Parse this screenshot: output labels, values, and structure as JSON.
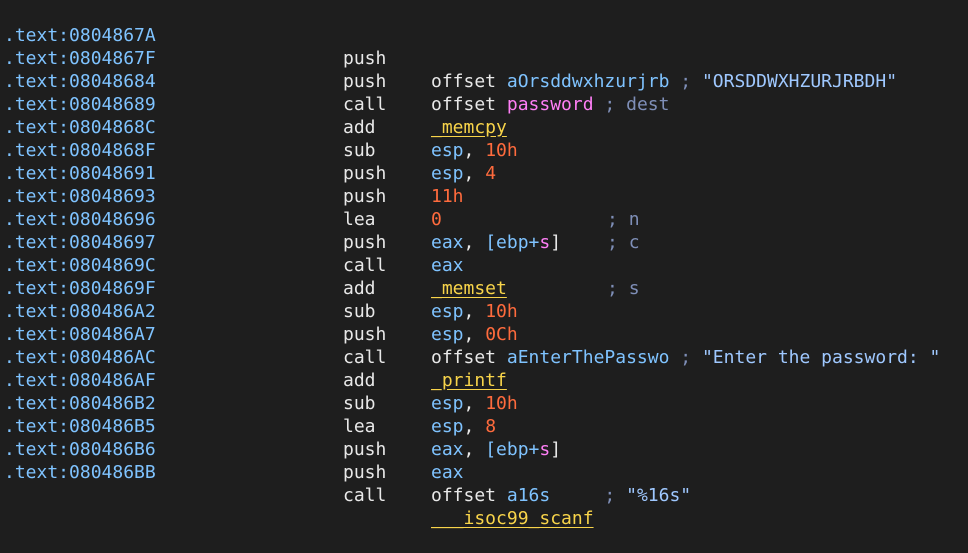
{
  "rows": [
    {
      "addr": ".text:0804867A",
      "mnem": "push",
      "kw": "offset",
      "label": "aOrsddwxhzurjrb",
      "semi": ";",
      "comment": "\"ORSDDWXHZURJRBDH\""
    },
    {
      "addr": ".text:0804867F",
      "mnem": "push",
      "kw": "offset",
      "var": "password",
      "semi": ";",
      "comment": "dest"
    },
    {
      "addr": ".text:08048684",
      "mnem": "call",
      "fn": "_memcpy"
    },
    {
      "addr": ".text:08048689",
      "mnem": "add",
      "reg": "esp",
      "sep": ",",
      "num": "10h"
    },
    {
      "addr": ".text:0804868C",
      "mnem": "sub",
      "reg": "esp",
      "sep": ",",
      "num": "4"
    },
    {
      "addr": ".text:0804868F",
      "mnem": "push",
      "num": "11h",
      "semi": ";",
      "comment": "n"
    },
    {
      "addr": ".text:08048691",
      "mnem": "push",
      "num": "0",
      "semi": ";",
      "comment": "c"
    },
    {
      "addr": ".text:08048693",
      "mnem": "lea",
      "reg": "eax",
      "sep": ",",
      "open": "[ebp+",
      "tag": "s",
      "close": "]"
    },
    {
      "addr": ".text:08048696",
      "mnem": "push",
      "reg": "eax",
      "semi": ";",
      "comment": "s"
    },
    {
      "addr": ".text:08048697",
      "mnem": "call",
      "fn": "_memset"
    },
    {
      "addr": ".text:0804869C",
      "mnem": "add",
      "reg": "esp",
      "sep": ",",
      "num": "10h"
    },
    {
      "addr": ".text:0804869F",
      "mnem": "sub",
      "reg": "esp",
      "sep": ",",
      "num": "0Ch"
    },
    {
      "addr": ".text:080486A2",
      "mnem": "push",
      "kw": "offset",
      "label": "aEnterThePasswo",
      "semi": ";",
      "comment": "\"Enter the password: \""
    },
    {
      "addr": ".text:080486A7",
      "mnem": "call",
      "fn": "_printf"
    },
    {
      "addr": ".text:080486AC",
      "mnem": "add",
      "reg": "esp",
      "sep": ",",
      "num": "10h"
    },
    {
      "addr": ".text:080486AF",
      "mnem": "sub",
      "reg": "esp",
      "sep": ",",
      "num": "8"
    },
    {
      "addr": ".text:080486B2",
      "mnem": "lea",
      "reg": "eax",
      "sep": ",",
      "open": "[ebp+",
      "tag": "s",
      "close": "]"
    },
    {
      "addr": ".text:080486B5",
      "mnem": "push",
      "reg": "eax"
    },
    {
      "addr": ".text:080486B6",
      "mnem": "push",
      "kw": "offset",
      "label": "a16s",
      "semi": ";",
      "comment": "\"%16s\""
    },
    {
      "addr": ".text:080486BB",
      "mnem": "call",
      "fn": "___isoc99_scanf"
    }
  ],
  "colors": {
    "background": "#1e1e1e",
    "address": "#7fc3ff",
    "number": "#ff6b3d",
    "function": "#f8d44a",
    "variable": "#ff7ff6",
    "comment": "#7f8fb8"
  }
}
